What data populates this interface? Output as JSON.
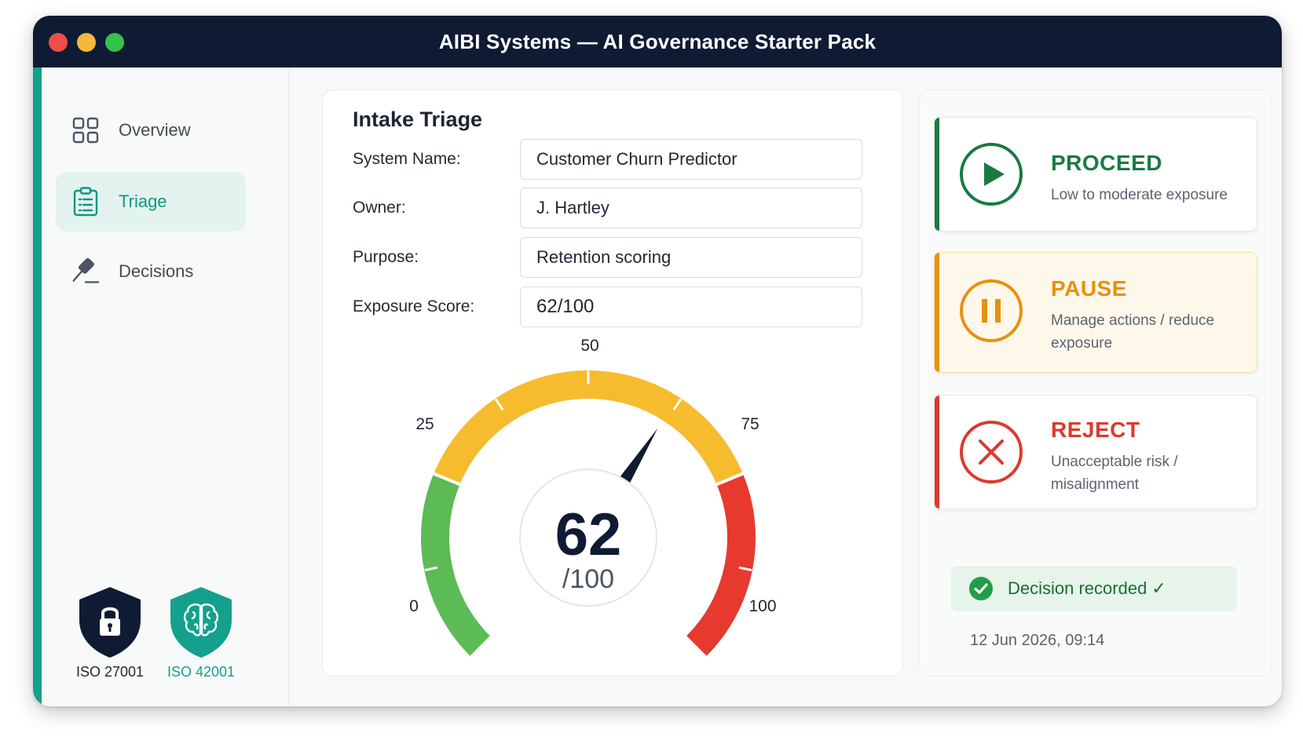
{
  "window": {
    "title": "AIBI Systems — AI Governance Starter Pack"
  },
  "sidebar": {
    "items": [
      {
        "label": "Overview",
        "icon": "grid-icon",
        "active": false
      },
      {
        "label": "Triage",
        "icon": "clipboard-icon",
        "active": true
      },
      {
        "label": "Decisions",
        "icon": "gavel-icon",
        "active": false
      }
    ],
    "certifications": [
      {
        "label": "ISO 27001",
        "icon": "lock-shield-icon",
        "color": "#0e1b33"
      },
      {
        "label": "ISO 42001",
        "icon": "brain-shield-icon",
        "color": "#14a08c"
      }
    ]
  },
  "triage": {
    "title": "Intake Triage",
    "fields": [
      {
        "label": "System Name:",
        "value": "Customer Churn Predictor"
      },
      {
        "label": "Owner:",
        "value": "J. Hartley"
      },
      {
        "label": "Purpose:",
        "value": "Retention scoring"
      },
      {
        "label": "Exposure Score:",
        "value": "62/100"
      }
    ],
    "gauge": {
      "value": 62,
      "value_text": "62",
      "max_text": "/100",
      "min": 0,
      "max": 100,
      "tick_labels": [
        "0",
        "25",
        "50",
        "75",
        "100"
      ],
      "bands": [
        {
          "from": 0,
          "to": 25,
          "color": "#5cbb55"
        },
        {
          "from": 25,
          "to": 75,
          "color": "#f7bb2e"
        },
        {
          "from": 75,
          "to": 100,
          "color": "#e7392e"
        }
      ],
      "needle_color": "#0e1b33"
    }
  },
  "decisions": {
    "options": [
      {
        "title": "PROCEED",
        "description": "Low to moderate exposure",
        "color": "#1a7a42",
        "icon": "play-icon"
      },
      {
        "title": "PAUSE",
        "description": "Manage actions / reduce exposure",
        "color": "#e8900f",
        "icon": "pause-icon"
      },
      {
        "title": "REJECT",
        "description": "Unacceptable risk / misalignment",
        "color": "#db3a2e",
        "icon": "close-icon"
      }
    ],
    "status": {
      "text": "Decision recorded ✓",
      "icon": "check-circle-icon",
      "timestamp": "12 Jun 2026, 09:14"
    }
  }
}
